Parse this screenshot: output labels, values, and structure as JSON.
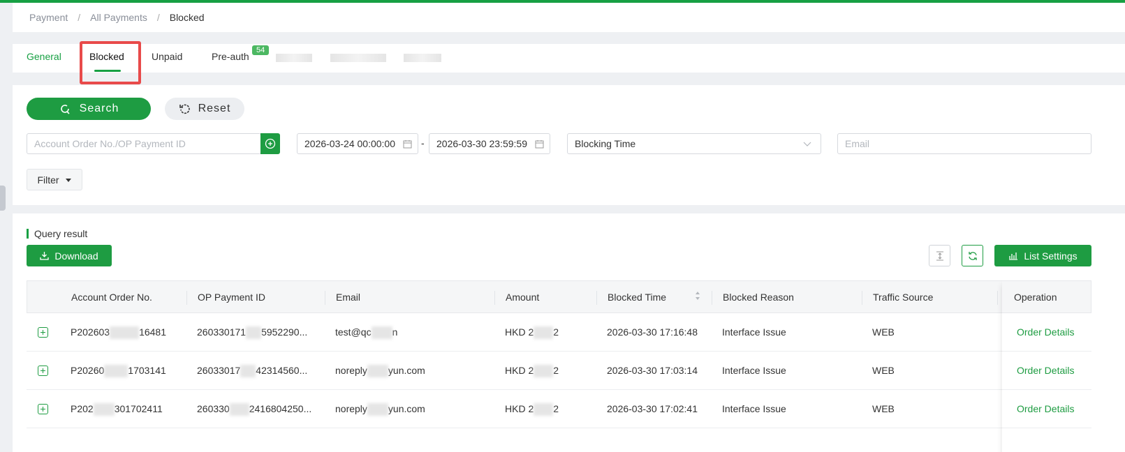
{
  "breadcrumb": {
    "items": [
      "Payment",
      "All Payments",
      "Blocked"
    ]
  },
  "tabs": {
    "general": "General",
    "blocked": "Blocked",
    "unpaid": "Unpaid",
    "preauth": "Pre-auth",
    "preauth_badge": "54"
  },
  "toolbar": {
    "search_label": "Search",
    "reset_label": "Reset"
  },
  "filters": {
    "order_placeholder": "Account Order No./OP Payment ID",
    "date_start": "2026-03-24 00:00:00",
    "date_separator": "-",
    "date_end": "2026-03-30 23:59:59",
    "time_type": "Blocking Time",
    "email_placeholder": "Email",
    "filter_label": "Filter"
  },
  "results": {
    "title": "Query result",
    "download_label": "Download",
    "list_settings_label": "List Settings"
  },
  "table": {
    "headers": [
      "Account Order No.",
      "OP Payment ID",
      "Email",
      "Amount",
      "Blocked Time",
      "Blocked Reason",
      "Traffic Source",
      "Operation"
    ],
    "rows": [
      {
        "order_a": "P202603",
        "order_b": "16481",
        "payment_a": "260330171",
        "payment_b": "5952290...",
        "email_a": "test@qc",
        "email_b": "n",
        "amount_a": "HKD 2",
        "amount_b": "2",
        "time": "2026-03-30 17:16:48",
        "reason": "Interface Issue",
        "source": "WEB",
        "op": "Order Details"
      },
      {
        "order_a": "P20260",
        "order_b": "1703141",
        "payment_a": "26033017",
        "payment_b": "42314560...",
        "email_a": "noreply",
        "email_b": "yun.com",
        "amount_a": "HKD 2",
        "amount_b": "2",
        "time": "2026-03-30 17:03:14",
        "reason": "Interface Issue",
        "source": "WEB",
        "op": "Order Details"
      },
      {
        "order_a": "P202",
        "order_b": "301702411",
        "payment_a": "260330",
        "payment_b": "2416804250...",
        "email_a": "noreply",
        "email_b": "yun.com",
        "amount_a": "HKD 2",
        "amount_b": "2",
        "time": "2026-03-30 17:02:41",
        "reason": "Interface Issue",
        "source": "WEB",
        "op": "Order Details"
      }
    ]
  },
  "colors": {
    "brand": "#1e9c42",
    "highlight": "#e84a4a"
  },
  "icons": [
    "search-icon",
    "reset-icon",
    "add-circle-icon",
    "calendar-icon",
    "chevron-down-icon",
    "caret-down-icon",
    "download-icon",
    "expand-rows-icon",
    "refresh-icon",
    "bar-chart-icon",
    "sort-icon",
    "expand-row-icon"
  ]
}
